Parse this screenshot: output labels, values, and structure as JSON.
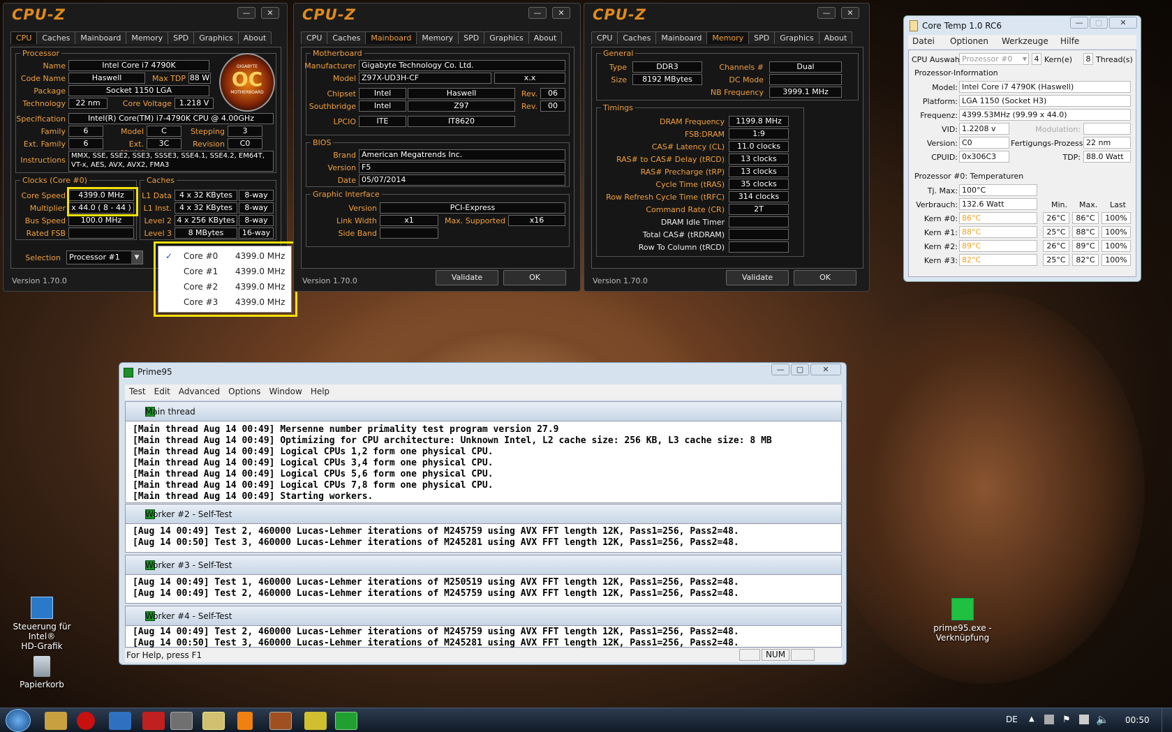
{
  "colors": {
    "accent": "#f0a040",
    "highlight_box": "#f2e20a",
    "core_temp_value": "#f0a020"
  },
  "cpuz": {
    "logo": "CPU-Z",
    "tabs": [
      "CPU",
      "Caches",
      "Mainboard",
      "Memory",
      "SPD",
      "Graphics",
      "About"
    ],
    "version": "Version 1.70.0",
    "validate": "Validate",
    "ok": "OK",
    "win1": {
      "active_tab": "CPU",
      "processor": "Processor",
      "name_l": "Name",
      "name": "Intel Core i7 4790K",
      "codename_l": "Code Name",
      "codename": "Haswell",
      "maxtdp_l": "Max TDP",
      "maxtdp": "88 W",
      "package_l": "Package",
      "package": "Socket 1150 LGA",
      "tech_l": "Technology",
      "tech": "22 nm",
      "cv_l": "Core Voltage",
      "cv": "1.218 V",
      "spec_l": "Specification",
      "spec": "Intel(R) Core(TM) i7-4790K CPU @ 4.00GHz",
      "family_l": "Family",
      "family": "6",
      "model_l": "Model",
      "model": "C",
      "stepping_l": "Stepping",
      "stepping": "3",
      "extfamily_l": "Ext. Family",
      "extfamily": "6",
      "extmodel_l": "Ext. Model",
      "extmodel": "3C",
      "revision_l": "Revision",
      "revision": "C0",
      "instr_l": "Instructions",
      "instr1": "MMX, SSE, SSE2, SSE3, SSSE3, SSE4.1, SSE4.2, EM64T,",
      "instr2": "VT-x, AES, AVX, AVX2, FMA3",
      "clocks": "Clocks (Core #0)",
      "cs_l": "Core Speed",
      "cs": "4399.0 MHz",
      "mult_l": "Multiplier",
      "mult": "x 44.0 ( 8 - 44 )",
      "bus_l": "Bus Speed",
      "bus": "100.0 MHz",
      "fsb_l": "Rated FSB",
      "fsb": "",
      "caches": "Caches",
      "l1d_l": "L1 Data",
      "l1d": "4 x 32 KBytes",
      "l1d_w": "8-way",
      "l1i_l": "L1 Inst.",
      "l1i": "4 x 32 KBytes",
      "l1i_w": "8-way",
      "l2_l": "Level 2",
      "l2": "4 x 256 KBytes",
      "l2_w": "8-way",
      "l3_l": "Level 3",
      "l3": "8 MBytes",
      "l3_w": "16-way",
      "sel_l": "Selection",
      "sel": "Processor #1",
      "badge_top": "GIGABYTE",
      "badge_main": "OC",
      "badge_bottom": "MOTHERBOARD"
    },
    "win2": {
      "active_tab": "Mainboard",
      "mb": "Motherboard",
      "man_l": "Manufacturer",
      "man": "Gigabyte Technology Co. Ltd.",
      "model_l": "Model",
      "model": "Z97X-UD3H-CF",
      "model_rev": "x.x",
      "chipset_l": "Chipset",
      "chipset_v": "Intel",
      "chipset_n": "Haswell",
      "rev_l": "Rev.",
      "chipset_rev": "06",
      "sb_l": "Southbridge",
      "sb_v": "Intel",
      "sb_n": "Z97",
      "sb_rev": "00",
      "lpcio_l": "LPCIO",
      "lpcio_v": "ITE",
      "lpcio_n": "IT8620",
      "bios": "BIOS",
      "brand_l": "Brand",
      "brand": "American Megatrends Inc.",
      "version_l": "Version",
      "version": "F5",
      "date_l": "Date",
      "date": "05/07/2014",
      "gi": "Graphic Interface",
      "giver_l": "Version",
      "giver": "PCI-Express",
      "lw_l": "Link Width",
      "lw": "x1",
      "ms_l": "Max. Supported",
      "ms": "x16",
      "sbd_l": "Side Band",
      "sbd": ""
    },
    "win3": {
      "active_tab": "Memory",
      "general": "General",
      "type_l": "Type",
      "type": "DDR3",
      "ch_l": "Channels #",
      "ch": "Dual",
      "size_l": "Size",
      "size": "8192 MBytes",
      "dc_l": "DC Mode",
      "dc": "",
      "nb_l": "NB Frequency",
      "nb": "3999.1 MHz",
      "timings": "Timings",
      "rows": [
        [
          "DRAM Frequency",
          "1199.8 MHz"
        ],
        [
          "FSB:DRAM",
          "1:9"
        ],
        [
          "CAS# Latency (CL)",
          "11.0 clocks"
        ],
        [
          "RAS# to CAS# Delay (tRCD)",
          "13 clocks"
        ],
        [
          "RAS# Precharge (tRP)",
          "13 clocks"
        ],
        [
          "Cycle Time (tRAS)",
          "35 clocks"
        ],
        [
          "Row Refresh Cycle Time (tRFC)",
          "314 clocks"
        ],
        [
          "Command Rate (CR)",
          "2T"
        ],
        [
          "DRAM Idle Timer",
          ""
        ],
        [
          "Total CAS# (tRDRAM)",
          ""
        ],
        [
          "Row To Column (tRCD)",
          ""
        ]
      ]
    }
  },
  "core_dropdown": [
    {
      "name": "Core #0",
      "mhz": "4399.0 MHz",
      "checked": "✓"
    },
    {
      "name": "Core #1",
      "mhz": "4399.0 MHz"
    },
    {
      "name": "Core #2",
      "mhz": "4399.0 MHz"
    },
    {
      "name": "Core #3",
      "mhz": "4399.0 MHz"
    }
  ],
  "coretemp": {
    "title": "Core Temp 1.0 RC6",
    "menu": [
      "Datei",
      "Optionen",
      "Werkzeuge",
      "Hilfe"
    ],
    "cpu_sel_l": "CPU Auswahl:",
    "cpu_sel": "Prozessor #0",
    "cores": "4",
    "cores_l": "Kern(e)",
    "threads": "8",
    "threads_l": "Thread(s)",
    "info": "Prozessor-Information",
    "model_l": "Model:",
    "model": "Intel Core i7 4790K (Haswell)",
    "platform_l": "Platform:",
    "platform": "LGA 1150 (Socket H3)",
    "freq_l": "Frequenz:",
    "freq": "4399.53MHz (99.99 x 44.0)",
    "vid_l": "VID:",
    "vid": "1.2208 v",
    "mod_l": "Modulation:",
    "mod": "",
    "version_l": "Version:",
    "version": "C0",
    "fp_l": "Fertigungs-Prozess:",
    "fp": "22 nm",
    "cpuid_l": "CPUID:",
    "cpuid": "0x306C3",
    "tdp_l": "TDP:",
    "tdp": "88.0 Watt",
    "temps": "Prozessor #0: Temperaturen",
    "tj_l": "Tj. Max:",
    "tj": "100°C",
    "power_l": "Verbrauch:",
    "power": "132.6 Watt",
    "min_h": "Min.",
    "max_h": "Max.",
    "last_h": "Last",
    "rows": [
      {
        "l": "Kern #0:",
        "t": "86°C",
        "min": "26°C",
        "max": "86°C",
        "load": "100%"
      },
      {
        "l": "Kern #1:",
        "t": "88°C",
        "min": "25°C",
        "max": "88°C",
        "load": "100%"
      },
      {
        "l": "Kern #2:",
        "t": "89°C",
        "min": "26°C",
        "max": "89°C",
        "load": "100%"
      },
      {
        "l": "Kern #3:",
        "t": "82°C",
        "min": "25°C",
        "max": "82°C",
        "load": "100%"
      }
    ]
  },
  "prime95": {
    "title": "Prime95",
    "menu": [
      "Test",
      "Edit",
      "Advanced",
      "Options",
      "Window",
      "Help"
    ],
    "sections": [
      {
        "title": "Main thread",
        "lines": [
          "[Main thread Aug 14 00:49] Mersenne number primality test program version 27.9",
          "[Main thread Aug 14 00:49] Optimizing for CPU architecture: Unknown Intel, L2 cache size: 256 KB, L3 cache size: 8 MB",
          "[Main thread Aug 14 00:49] Logical CPUs 1,2 form one physical CPU.",
          "[Main thread Aug 14 00:49] Logical CPUs 3,4 form one physical CPU.",
          "[Main thread Aug 14 00:49] Logical CPUs 5,6 form one physical CPU.",
          "[Main thread Aug 14 00:49] Logical CPUs 7,8 form one physical CPU.",
          "[Main thread Aug 14 00:49] Starting workers."
        ]
      },
      {
        "title": "Worker #2 - Self-Test",
        "lines": [
          "[Aug 14 00:49] Test 2, 460000 Lucas-Lehmer iterations of M245759 using AVX FFT length 12K, Pass1=256, Pass2=48.",
          "[Aug 14 00:50] Test 3, 460000 Lucas-Lehmer iterations of M245281 using AVX FFT length 12K, Pass1=256, Pass2=48."
        ]
      },
      {
        "title": "Worker #3 - Self-Test",
        "lines": [
          "[Aug 14 00:49] Test 1, 460000 Lucas-Lehmer iterations of M250519 using AVX FFT length 12K, Pass1=256, Pass2=48.",
          "[Aug 14 00:49] Test 2, 460000 Lucas-Lehmer iterations of M245759 using AVX FFT length 12K, Pass1=256, Pass2=48."
        ]
      },
      {
        "title": "Worker #4 - Self-Test",
        "lines": [
          "[Aug 14 00:49] Test 2, 460000 Lucas-Lehmer iterations of M245759 using AVX FFT length 12K, Pass1=256, Pass2=48.",
          "[Aug 14 00:50] Test 3, 460000 Lucas-Lehmer iterations of M245281 using AVX FFT length 12K, Pass1=256, Pass2=48."
        ]
      }
    ],
    "status": "For Help, press F1",
    "num": "NUM"
  },
  "desktop": {
    "icon1_l1": "Steuerung für Intel®",
    "icon1_l2": "HD-Grafik",
    "icon2": "Papierkorb",
    "icon3_l1": "prime95.exe -",
    "icon3_l2": "Verknüpfung"
  },
  "taskbar": {
    "lang": "DE",
    "clock": "00:50"
  }
}
